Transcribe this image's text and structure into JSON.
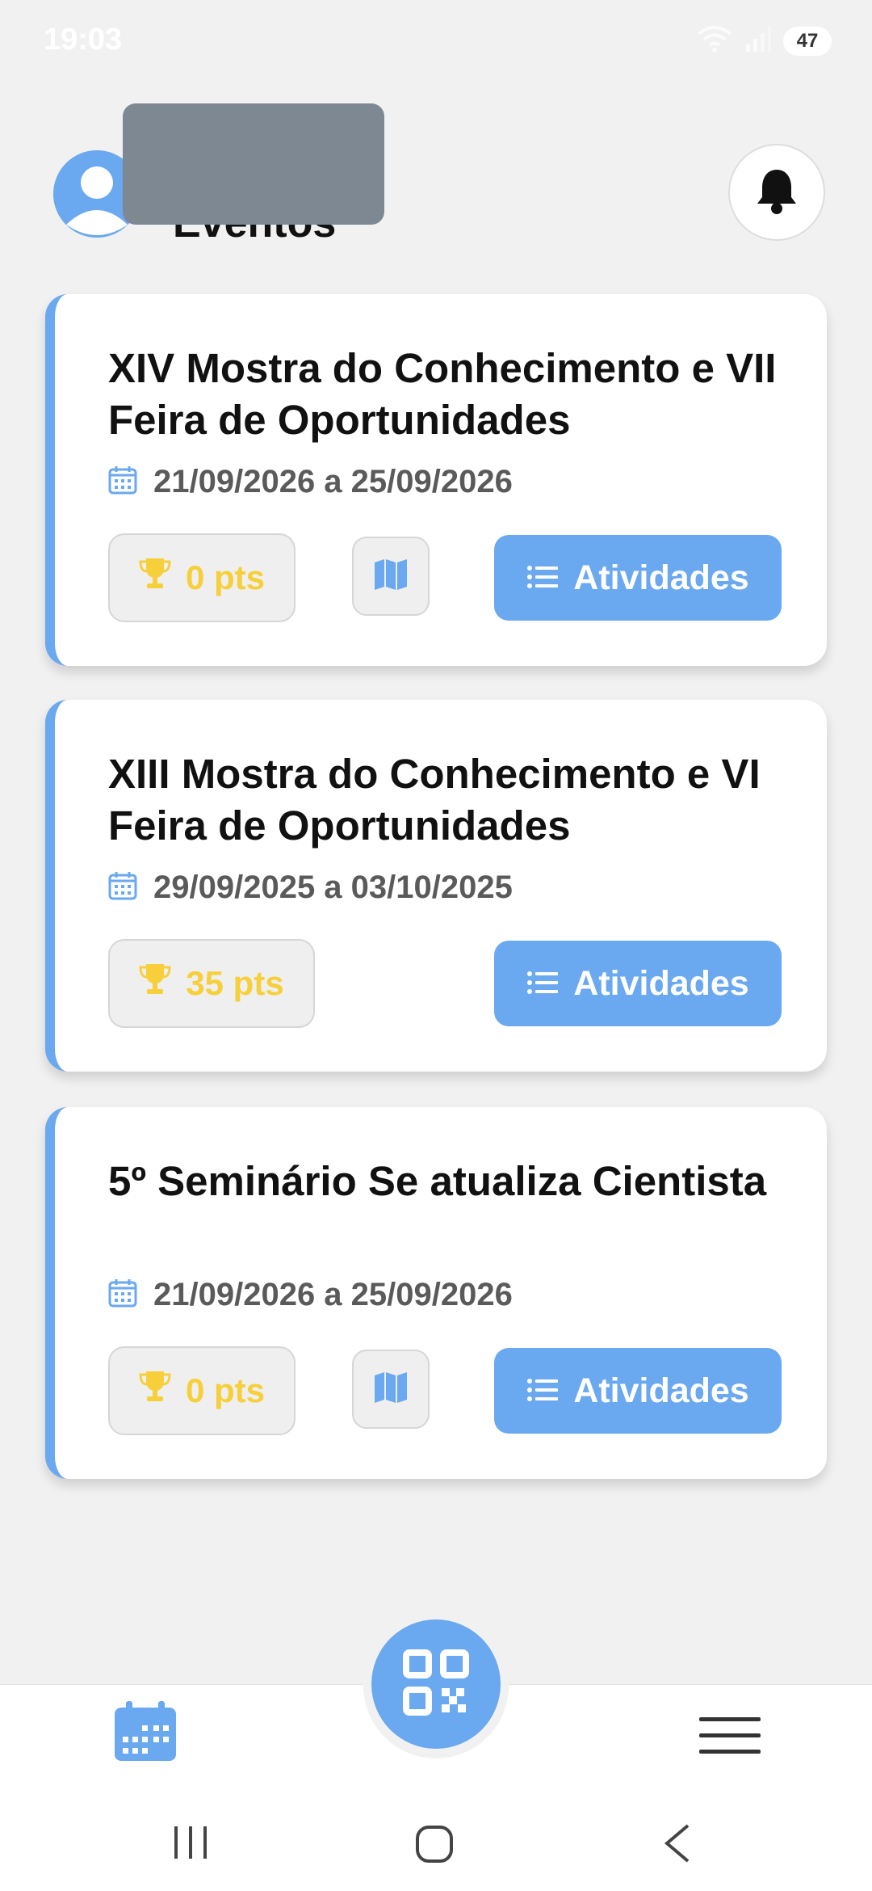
{
  "status_bar": {
    "time": "19:03",
    "battery": "47"
  },
  "header": {
    "title": "Eventos"
  },
  "events": [
    {
      "title": "XIV Mostra do Conhecimento e VII Feira de Oportunidades",
      "date_range": "21/09/2026 a 25/09/2026",
      "points": "0 pts",
      "has_map": true,
      "activities_label": "Atividades"
    },
    {
      "title": "XIII Mostra do Conhecimento e VI Feira de Oportunidades",
      "date_range": "29/09/2025 a 03/10/2025",
      "points": "35 pts",
      "has_map": false,
      "activities_label": "Atividades"
    },
    {
      "title": "5º Seminário Se atualiza Cientista",
      "date_range": "21/09/2026 a 25/09/2026",
      "points": "0 pts",
      "has_map": true,
      "activities_label": "Atividades"
    }
  ],
  "icons": {
    "avatar": "user-avatar-icon",
    "notifications": "bell-icon",
    "date": "calendar-icon",
    "points": "trophy-icon",
    "map": "map-icon",
    "activities": "list-icon",
    "nav_events": "calendar-icon",
    "nav_scan": "qr-code-icon",
    "nav_menu": "menu-icon"
  },
  "colors": {
    "accent": "#6aa8ef",
    "points": "#f6cf3a",
    "background": "#f1f1f1",
    "redaction": "#7e8893"
  }
}
